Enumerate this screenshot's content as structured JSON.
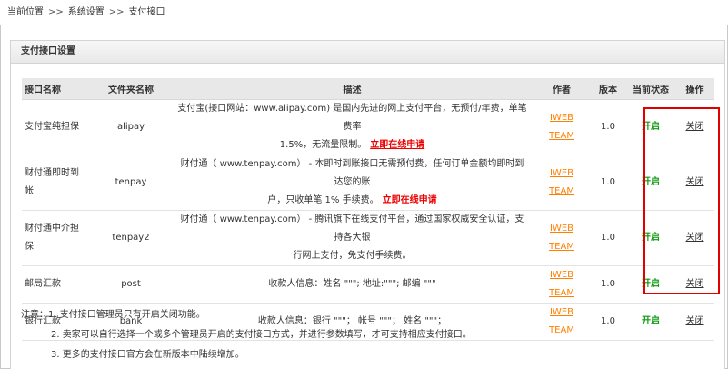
{
  "breadcrumb": {
    "items": [
      "当前位置",
      "系统设置",
      "支付接口"
    ],
    "separator": ">>"
  },
  "panel": {
    "title": "支付接口设置"
  },
  "table": {
    "headers": {
      "name": "接口名称",
      "folder": "文件夹名称",
      "desc": "描述",
      "author": "作者",
      "version": "版本",
      "status": "当前状态",
      "action": "操作"
    },
    "rows": [
      {
        "name": "支付宝纯担保",
        "folder": "alipay",
        "desc_line1": "支付宝(接口网站：www.alipay.com) 是国内先进的网上支付平台，无预付/年费，单笔费率",
        "desc_line2": "1.5%，无流量限制。",
        "apply_label": "立即在线申请",
        "author": "IWEB TEAM",
        "version": "1.0",
        "status": "开启",
        "action": "关闭"
      },
      {
        "name": "财付通即时到帐",
        "folder": "tenpay",
        "desc_line1": "财付通（ www.tenpay.com） - 本即时到账接口无需预付费，任何订单金额均即时到达您的账",
        "desc_line2": "户，只收单笔 1% 手续费。",
        "apply_label": "立即在线申请",
        "author": "IWEB TEAM",
        "version": "1.0",
        "status": "开启",
        "action": "关闭"
      },
      {
        "name": "财付通中介担保",
        "folder": "tenpay2",
        "desc_line1": "财付通（ www.tenpay.com） - 腾讯旗下在线支付平台，通过国家权威安全认证，支持各大银",
        "desc_line2": "行网上支付，免支付手续费。",
        "author": "IWEB TEAM",
        "version": "1.0",
        "status": "开启",
        "action": "关闭"
      },
      {
        "name": "邮局汇款",
        "folder": "post",
        "desc_line1": "收款人信息：姓名 \"\"\"; 地址:\"\"\"; 邮编 \"\"\"",
        "author": "IWEB TEAM",
        "version": "1.0",
        "status": "开启",
        "action": "关闭"
      },
      {
        "name": "银行汇款",
        "folder": "bank",
        "desc_line1": "收款人信息：银行 \"\"\"； 帐号 \"\"\"； 姓名 \"\"\"；",
        "author": "IWEB TEAM",
        "version": "1.0",
        "status": "开启",
        "action": "关闭"
      }
    ]
  },
  "notes": {
    "head": "注意：1. 支付接口管理员只有开启关闭功能。",
    "item2": "2. 卖家可以自行选择一个或多个管理员开启的支付接口方式，并进行参数填写，才可支持相应支付接口。",
    "item3": "3. 更多的支付接口官方会在新版本中陆续增加。"
  },
  "colors": {
    "highlight_border": "#e00000",
    "status_on": "#119911",
    "author_link": "#ff7f00",
    "apply_link": "#ee0000",
    "header_bg": "#e8e8e8"
  }
}
